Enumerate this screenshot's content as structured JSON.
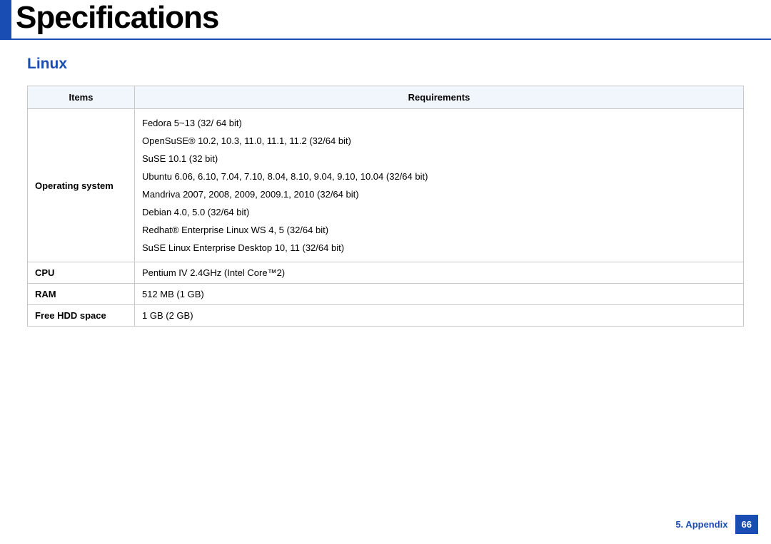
{
  "page_title": "Specifications",
  "section_title": "Linux",
  "table": {
    "headers": {
      "items": "Items",
      "requirements": "Requirements"
    },
    "rows": [
      {
        "item": "Operating system",
        "requirement_list": [
          "Fedora 5~13 (32/ 64 bit)",
          "OpenSuSE® 10.2, 10.3, 11.0, 11.1, 11.2 (32/64 bit)",
          "SuSE 10.1 (32 bit)",
          "Ubuntu 6.06, 6.10, 7.04, 7.10, 8.04, 8.10, 9.04, 9.10, 10.04 (32/64 bit)",
          "Mandriva 2007, 2008, 2009, 2009.1, 2010 (32/64 bit)",
          "Debian 4.0, 5.0 (32/64 bit)",
          "Redhat® Enterprise Linux WS 4, 5 (32/64 bit)",
          "SuSE Linux Enterprise Desktop 10, 11 (32/64 bit)"
        ]
      },
      {
        "item": "CPU",
        "requirement": "Pentium IV 2.4GHz (Intel Core™2)"
      },
      {
        "item": "RAM",
        "requirement": "512 MB (1 GB)"
      },
      {
        "item": "Free HDD space",
        "requirement": "1 GB (2 GB)"
      }
    ]
  },
  "footer": {
    "section": "5. Appendix",
    "page": "66"
  }
}
